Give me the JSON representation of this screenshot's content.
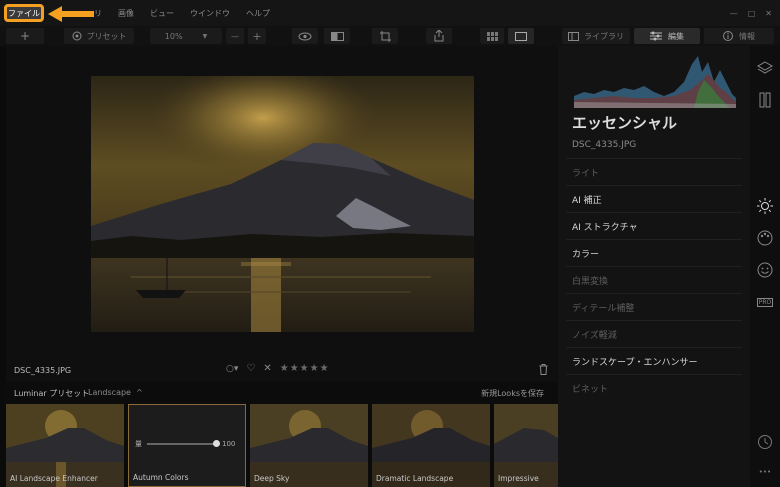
{
  "menu": {
    "file": "ファイル",
    "items": [
      "リ",
      "画像",
      "ビュー",
      "ウインドウ",
      "ヘルプ"
    ]
  },
  "toolbar": {
    "add_label": "+",
    "presets_label": "プリセット",
    "zoom": "10%",
    "zoom_minus": "—",
    "zoom_plus": "+",
    "tab_library": "ライブラリ",
    "tab_edit": "編集",
    "tab_info": "情報"
  },
  "image": {
    "filename": "DSC_4335.JPG",
    "rating_stars": "★★★★★"
  },
  "presets": {
    "title": "Luminar プリセット",
    "category": "Landscape",
    "save_looks": "新規Looksを保存",
    "amount_label": "量",
    "amount_value": "100",
    "amount_fraction": 1.0,
    "items": [
      {
        "label": "AI Landscape Enhancer"
      },
      {
        "label": "Autumn Colors"
      },
      {
        "label": "Deep Sky"
      },
      {
        "label": "Dramatic Landscape"
      },
      {
        "label": "Impressive"
      }
    ]
  },
  "panel": {
    "title": "エッセンシャル",
    "filename": "DSC_4335.JPG",
    "tools": [
      {
        "label": "ライト",
        "bright": false
      },
      {
        "label": "AI 補正",
        "bright": true
      },
      {
        "label": "AI ストラクチャ",
        "bright": true
      },
      {
        "label": "カラー",
        "bright": true
      },
      {
        "label": "白黒変換",
        "bright": false
      },
      {
        "label": "ディテール補整",
        "bright": false
      },
      {
        "label": "ノイズ軽減",
        "bright": false
      },
      {
        "label": "ランドスケープ・エンハンサー",
        "bright": true
      },
      {
        "label": "ビネット",
        "bright": false
      }
    ]
  },
  "rail": {
    "pro_label": "PRO"
  },
  "colors": {
    "highlight": "#f5a020",
    "background": "#0b0b0c",
    "panel": "#131314"
  },
  "icons": [
    "add-icon",
    "presets-icon",
    "eye-icon",
    "compare-icon",
    "crop-icon",
    "share-icon",
    "grid-view-icon",
    "single-view-icon",
    "library-icon",
    "sliders-icon",
    "info-icon",
    "layers-icon",
    "canvas-icon",
    "sun-icon",
    "palette-icon",
    "smile-icon",
    "pro-icon",
    "history-icon",
    "more-icon",
    "heart-icon",
    "reject-icon",
    "trash-icon",
    "arrow-icon"
  ]
}
